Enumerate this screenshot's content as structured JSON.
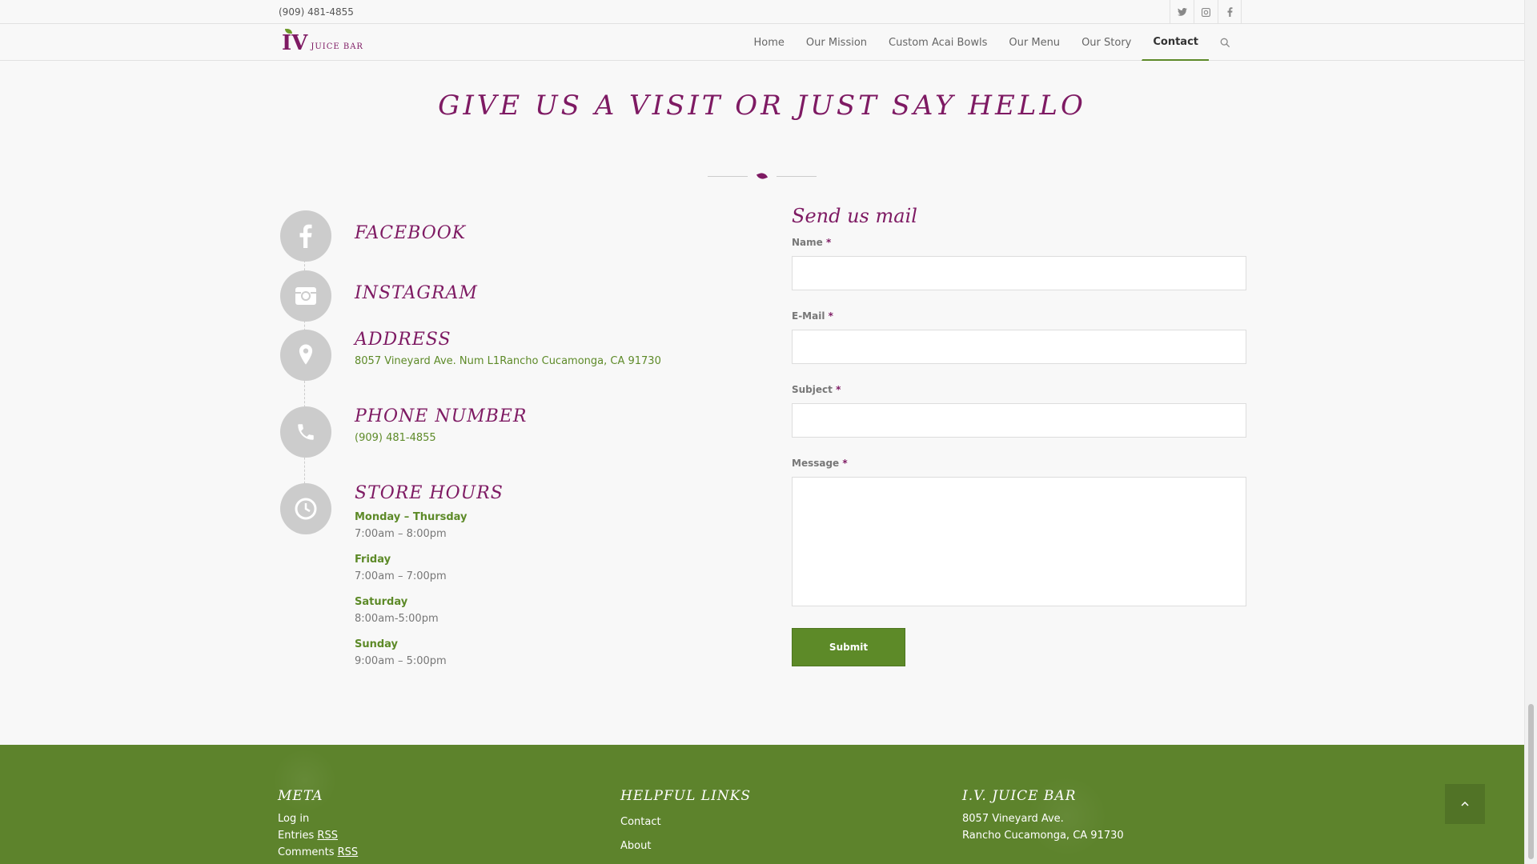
{
  "topbar": {
    "phone": "(909) 481-4855",
    "socials": [
      "twitter-icon",
      "instagram-icon",
      "facebook-icon"
    ]
  },
  "header": {
    "logo_mark": "IV",
    "logo_text": "JUICE BAR",
    "nav": [
      "Home",
      "Our Mission",
      "Custom Acai Bowls",
      "Our Menu",
      "Our Story",
      "Contact"
    ],
    "active_nav": "Contact"
  },
  "section": {
    "title": "GIVE US A VISIT OR JUST SAY HELLO"
  },
  "contact": {
    "facebook": "FACEBOOK",
    "instagram": "INSTAGRAM",
    "address_title": "ADDRESS",
    "address_text": "8057 Vineyard Ave. Num L1Rancho Cucamonga, CA 91730",
    "phone_title": "PHONE NUMBER",
    "phone_text": "(909) 481-4855",
    "hours_title": "STORE HOURS",
    "hours": [
      {
        "day": "Monday – Thursday",
        "time": "7:00am – 8:00pm"
      },
      {
        "day": "Friday",
        "time": "7:00am – 7:00pm"
      },
      {
        "day": "Saturday",
        "time": "8:00am-5:00pm"
      },
      {
        "day": "Sunday",
        "time": "9:00am – 5:00pm"
      }
    ]
  },
  "form": {
    "title": "Send us mail",
    "name_label": "Name",
    "email_label": "E-Mail",
    "subject_label": "Subject",
    "message_label": "Message",
    "required_mark": "*",
    "submit": "Submit"
  },
  "footer": {
    "meta_title": "META",
    "meta_links": [
      "Log in",
      "Entries",
      "Comments"
    ],
    "rss": "RSS",
    "helpful_title": "HELPFUL LINKS",
    "helpful_links": [
      "Contact",
      "About"
    ],
    "biz_title": "I.V. JUICE BAR",
    "biz_line1": "8057 Vineyard Ave.",
    "biz_line2": "Rancho Cucamonga, CA 91730"
  },
  "colors": {
    "brand_purple": "#7e1a63",
    "brand_green": "#5d8a28",
    "footer_green": "#5d832c"
  }
}
